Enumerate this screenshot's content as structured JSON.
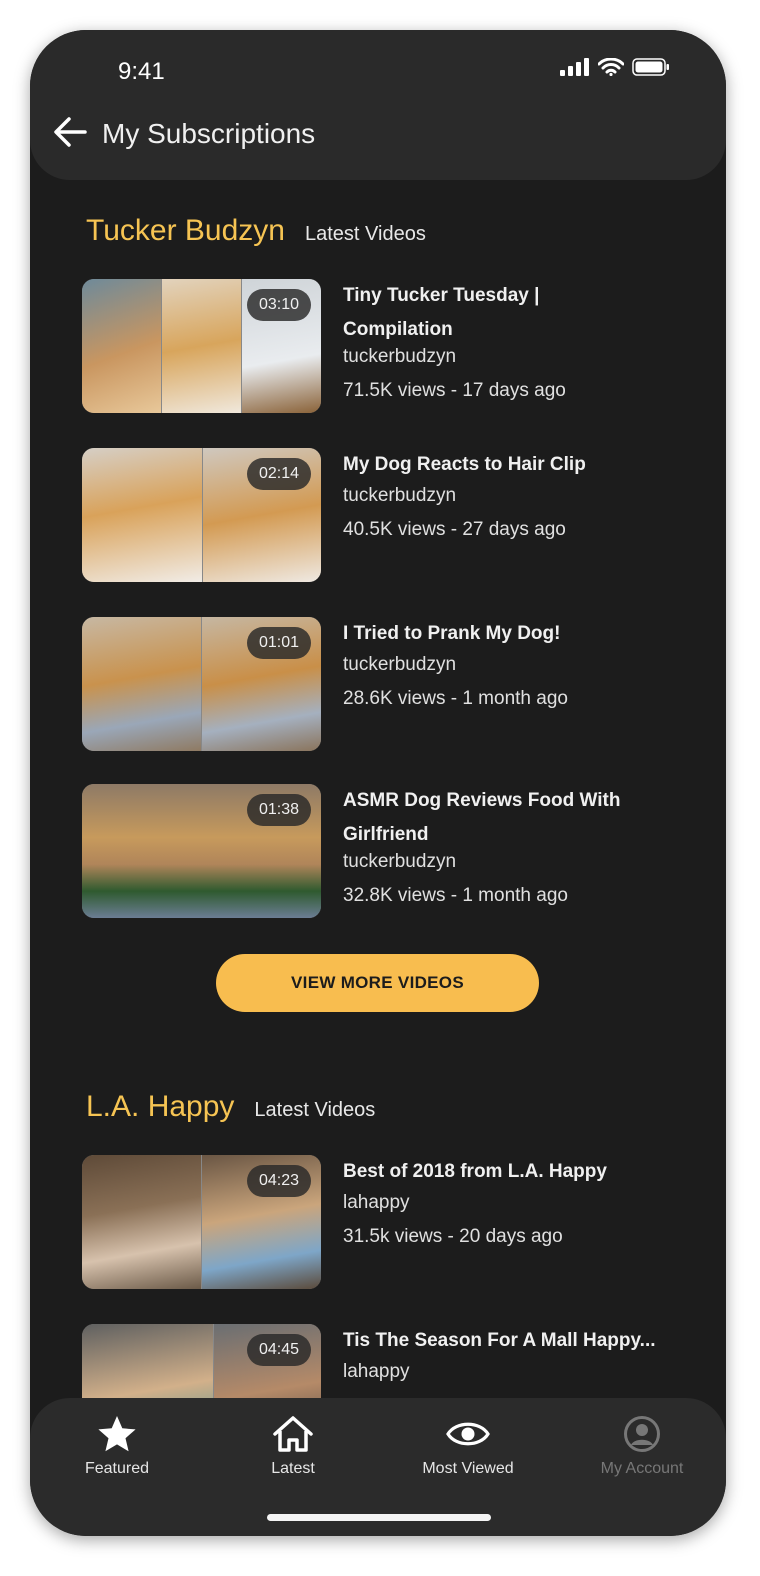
{
  "status_bar": {
    "time": "9:41"
  },
  "header": {
    "title": "My Subscriptions"
  },
  "sections": [
    {
      "channel": "Tucker Budzyn",
      "subtitle": "Latest Videos",
      "videos": [
        {
          "title_line1": "Tiny Tucker Tuesday |",
          "title_line2": "Compilation",
          "channel": "tuckerbudzyn",
          "meta": "71.5K views - 17 days ago",
          "duration": "03:10"
        },
        {
          "title_line1": "My Dog Reacts to Hair Clip",
          "title_line2": "",
          "channel": "tuckerbudzyn",
          "meta": "40.5K views - 27 days ago",
          "duration": "02:14"
        },
        {
          "title_line1": "I Tried to Prank My Dog!",
          "title_line2": "",
          "channel": "tuckerbudzyn",
          "meta": "28.6K views - 1 month ago",
          "duration": "01:01"
        },
        {
          "title_line1": "ASMR Dog Reviews Food With",
          "title_line2": "Girlfriend",
          "channel": "tuckerbudzyn",
          "meta": "32.8K views - 1 month ago",
          "duration": "01:38"
        }
      ],
      "view_more_label": "VIEW MORE VIDEOS"
    },
    {
      "channel": "L.A. Happy",
      "subtitle": "Latest Videos",
      "videos": [
        {
          "title_line1": "Best of 2018 from L.A. Happy",
          "title_line2": "",
          "channel": "lahappy",
          "meta": "31.5k views - 20 days ago",
          "duration": "04:23"
        },
        {
          "title_line1": "Tis The Season For A Mall Happy...",
          "title_line2": "",
          "channel": "lahappy",
          "meta": "",
          "duration": "04:45"
        }
      ]
    }
  ],
  "bottom_nav": [
    {
      "label": "Featured",
      "icon": "star-icon",
      "state": "active"
    },
    {
      "label": "Latest",
      "icon": "home-icon",
      "state": "active"
    },
    {
      "label": "Most Viewed",
      "icon": "eye-icon",
      "state": "active"
    },
    {
      "label": "My Account",
      "icon": "account-icon",
      "state": "muted"
    }
  ],
  "colors": {
    "background": "#1c1c1c",
    "header": "#2a2a2a",
    "accent": "#f6c453",
    "button": "#f8bd4f",
    "nav": "#2b2b2b"
  }
}
